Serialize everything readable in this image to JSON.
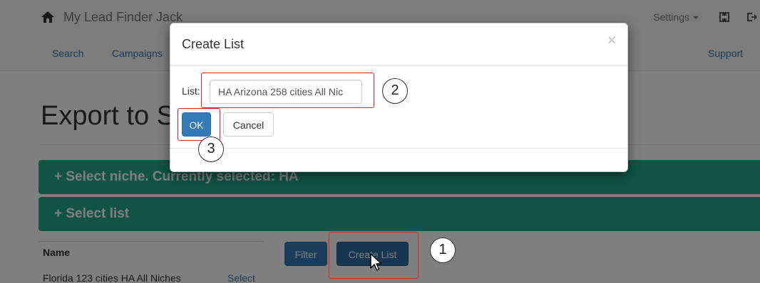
{
  "navbar": {
    "brand": "My Lead Finder Jack",
    "settings_label": "Settings",
    "links": [
      "Search",
      "Campaigns"
    ],
    "support_label": "Support"
  },
  "page": {
    "title": "Export to S",
    "niche_panel": "+ Select niche. Currently selected: HA",
    "list_panel": "+ Select list",
    "name_header": "Name",
    "rows": [
      {
        "name": "Florida 123 cities HA All Niches",
        "action": "Select"
      }
    ],
    "filter_label": "Filter",
    "create_list_label": "Create List"
  },
  "modal": {
    "title": "Create List",
    "close_glyph": "×",
    "list_label": "List:",
    "list_value": "HA Arizona 258 cities All Nic",
    "ok_label": "OK",
    "cancel_label": "Cancel"
  },
  "annotations": {
    "step_1": "1",
    "step_2": "2",
    "step_3": "3",
    "highlight_color": "#e02020"
  },
  "colors": {
    "primary": "#337ab7",
    "panel": "#22a889"
  }
}
